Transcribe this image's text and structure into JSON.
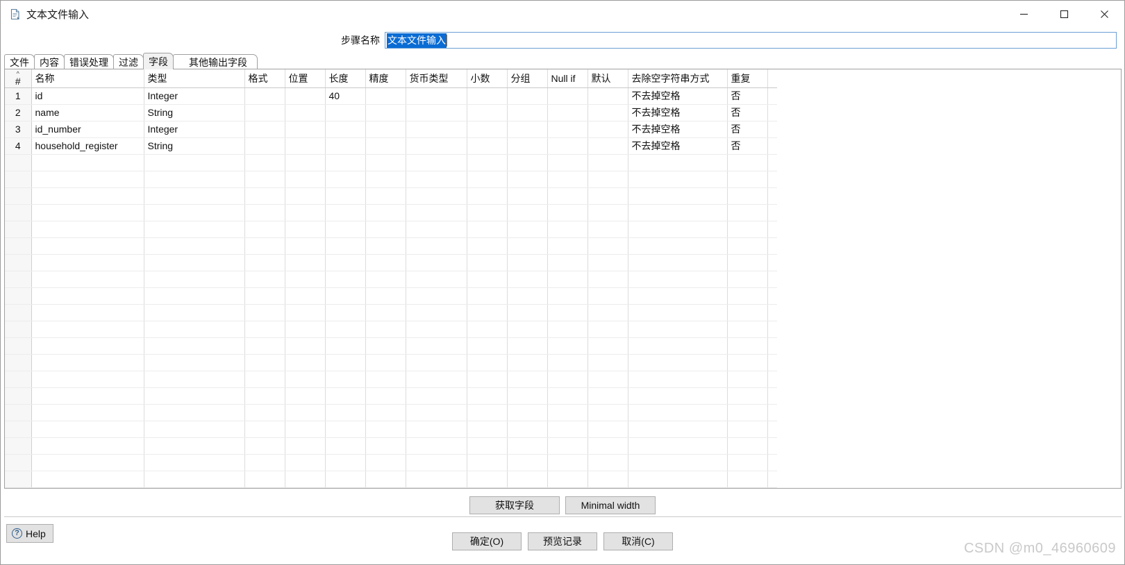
{
  "window": {
    "title": "文本文件输入",
    "icon": "text-file-icon",
    "controls": {
      "minimize": "—",
      "maximize": "□",
      "close": "✕"
    }
  },
  "step": {
    "label": "步骤名称",
    "value": "文本文件输入",
    "selected": true
  },
  "tabs": [
    {
      "label": "文件",
      "selected": false
    },
    {
      "label": "内容",
      "selected": false
    },
    {
      "label": "错误处理",
      "selected": false
    },
    {
      "label": "过滤",
      "selected": false
    },
    {
      "label": "字段",
      "selected": true
    },
    {
      "label": "其他输出字段",
      "selected": false
    }
  ],
  "grid": {
    "index_header": "#",
    "sort_indicator": "^",
    "columns": [
      "名称",
      "类型",
      "格式",
      "位置",
      "长度",
      "精度",
      "货币类型",
      "小数",
      "分组",
      "Null if",
      "默认",
      "去除空字符串方式",
      "重复"
    ],
    "rows": [
      {
        "index": "1",
        "name": "id",
        "type": "Integer",
        "format": "",
        "position": "",
        "length": "40",
        "precision": "",
        "currency": "",
        "decimal": "",
        "group": "",
        "null_if": "",
        "default": "",
        "trim": "不去掉空格",
        "repeat": "否"
      },
      {
        "index": "2",
        "name": "name",
        "type": "String",
        "format": "",
        "position": "",
        "length": "",
        "precision": "",
        "currency": "",
        "decimal": "",
        "group": "",
        "null_if": "",
        "default": "",
        "trim": "不去掉空格",
        "repeat": "否"
      },
      {
        "index": "3",
        "name": "id_number",
        "type": "Integer",
        "format": "",
        "position": "",
        "length": "",
        "precision": "",
        "currency": "",
        "decimal": "",
        "group": "",
        "null_if": "",
        "default": "",
        "trim": "不去掉空格",
        "repeat": "否"
      },
      {
        "index": "4",
        "name": "household_register",
        "type": "String",
        "format": "",
        "position": "",
        "length": "",
        "precision": "",
        "currency": "",
        "decimal": "",
        "group": "",
        "null_if": "",
        "default": "",
        "trim": "不去掉空格",
        "repeat": "否"
      }
    ],
    "empty_row_count": 20
  },
  "mid_buttons": {
    "get_fields": "获取字段",
    "minimal_width": "Minimal width"
  },
  "bottom_buttons": {
    "help": "Help",
    "help_icon": "question-circle-icon",
    "ok": "确定(O)",
    "preview": "预览记录",
    "cancel": "取消(C)"
  },
  "watermark": "CSDN @m0_46960609",
  "colors": {
    "selection_blue": "#0a6cd4",
    "window_border": "#9a9a9a",
    "button_face": "#e2e2e2",
    "watermark_gray": "#c9c9c9"
  }
}
